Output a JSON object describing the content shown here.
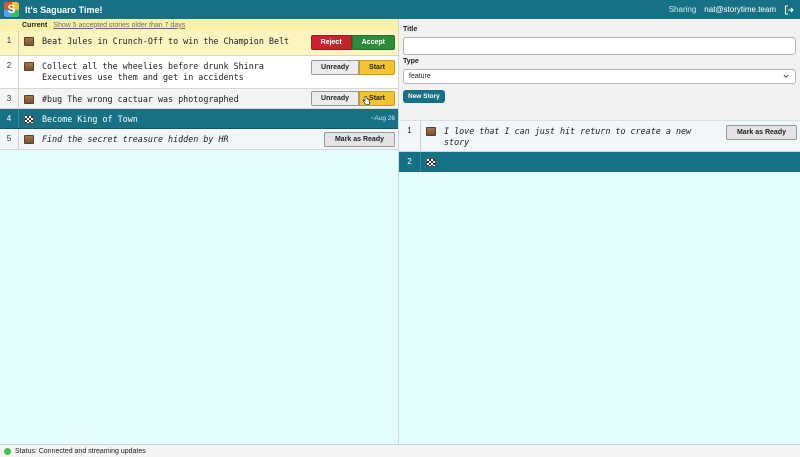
{
  "header": {
    "title": "It's Saguaro Time!",
    "sharing": "Sharing",
    "email": "nat@storytime.team",
    "logo_letter": "S"
  },
  "current": {
    "label": "Current",
    "older_link": "Show 5 accepted stories older than 7 days"
  },
  "stories": [
    {
      "num": "1",
      "text": "Beat Jules in Crunch-Off to win the Champion Belt",
      "icon": "chest-icon",
      "btn1": "Reject",
      "btn2": "Accept"
    },
    {
      "num": "2",
      "text": "Collect all the wheelies before drunk Shinra Executives use them and get in accidents",
      "icon": "chest-icon",
      "btn1": "Unready",
      "btn2": "Start"
    },
    {
      "num": "3",
      "text": "#bug The wrong cactuar was photographed",
      "icon": "chest-icon",
      "btn1": "Unready",
      "btn2": "Start"
    },
    {
      "num": "4",
      "text": "Become King of Town",
      "icon": "checkered-flag-icon",
      "date": "~Aug 26"
    },
    {
      "num": "5",
      "text": "Find the secret treasure hidden by HR",
      "icon": "chest-icon",
      "btn1": "Mark as Ready"
    }
  ],
  "form": {
    "title_label": "Title",
    "title_value": "",
    "type_label": "Type",
    "type_value": "feature",
    "new_story": "New Story"
  },
  "backlog": [
    {
      "num": "1",
      "text": "I love that I can just hit return to create a new story",
      "icon": "chest-icon",
      "btn": "Mark as Ready"
    },
    {
      "num": "2",
      "text": "",
      "icon": "checkered-flag-icon"
    }
  ],
  "status": {
    "text": "Status: Connected and streaming updates",
    "color": "#4bbf4e"
  },
  "colors": {
    "primary": "#177185",
    "current_bar": "#fbf1a9",
    "reject": "#c9222f",
    "accept": "#2f8a3c",
    "start": "#f4c430"
  }
}
